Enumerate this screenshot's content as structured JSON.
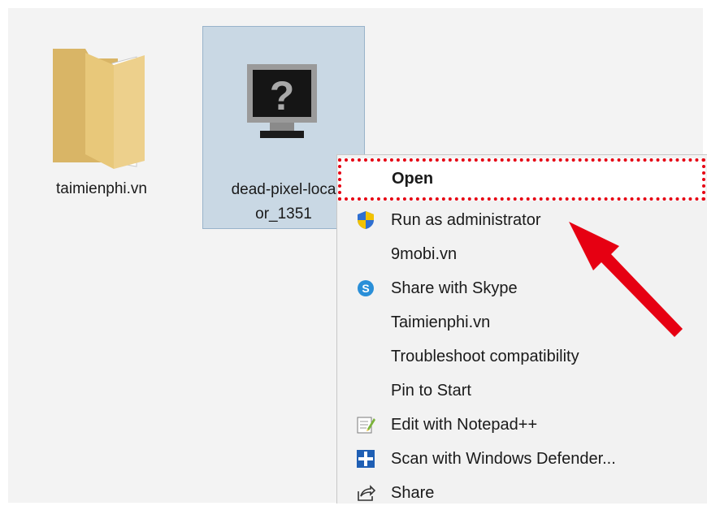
{
  "desktop": {
    "icons": [
      {
        "label": "taimienphi.vn"
      },
      {
        "label_line1": "dead-pixel-loca",
        "label_line2": "or_1351"
      }
    ]
  },
  "context_menu": {
    "items": [
      {
        "label": "Open",
        "icon": "none"
      },
      {
        "label": "Run as administrator",
        "icon": "uac-shield-icon"
      },
      {
        "label": "9mobi.vn",
        "icon": "none"
      },
      {
        "label": "Share with Skype",
        "icon": "skype-icon"
      },
      {
        "label": "Taimienphi.vn",
        "icon": "none"
      },
      {
        "label": "Troubleshoot compatibility",
        "icon": "none"
      },
      {
        "label": "Pin to Start",
        "icon": "none"
      },
      {
        "label": "Edit with Notepad++",
        "icon": "notepadpp-icon"
      },
      {
        "label": "Scan with Windows Defender...",
        "icon": "defender-icon"
      },
      {
        "label": "Share",
        "icon": "share-icon"
      }
    ]
  },
  "annotation": {
    "highlight_color": "#e60012",
    "arrow_color": "#e60012"
  }
}
